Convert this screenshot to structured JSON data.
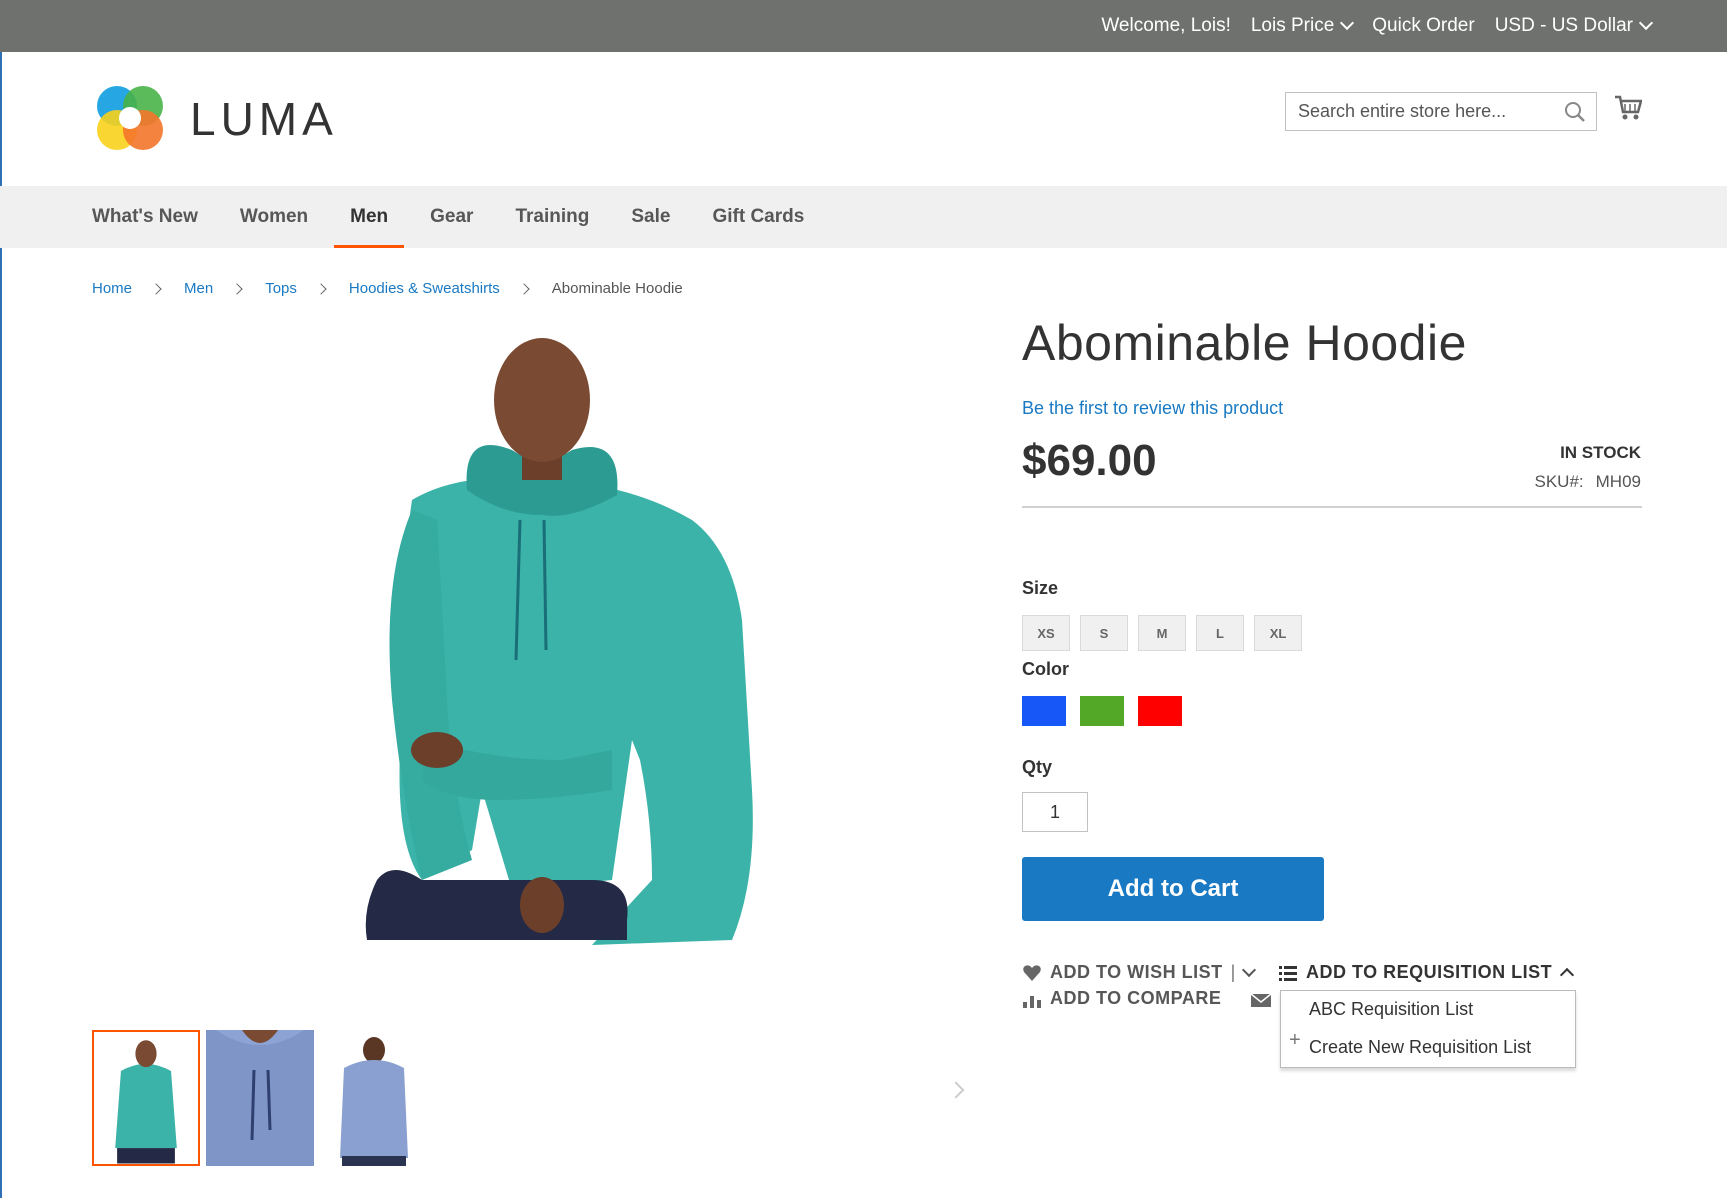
{
  "topbar": {
    "welcome": "Welcome, Lois!",
    "account": "Lois Price",
    "quick_order": "Quick Order",
    "currency": "USD - US Dollar"
  },
  "header": {
    "logo_text": "LUMA",
    "search_placeholder": "Search entire store here...",
    "icons": [
      "search-icon",
      "cart-icon"
    ]
  },
  "nav": {
    "items": [
      {
        "label": "What's New"
      },
      {
        "label": "Women"
      },
      {
        "label": "Men",
        "active": true
      },
      {
        "label": "Gear"
      },
      {
        "label": "Training"
      },
      {
        "label": "Sale"
      },
      {
        "label": "Gift Cards"
      }
    ]
  },
  "breadcrumb": {
    "items": [
      "Home",
      "Men",
      "Tops",
      "Hoodies & Sweatshirts"
    ],
    "current": "Abominable Hoodie"
  },
  "product": {
    "name": "Abominable Hoodie",
    "review_link": "Be the first to review this product",
    "price": "$69.00",
    "stock": "In stock",
    "sku_label": "SKU#:",
    "sku": "MH09",
    "size_label": "Size",
    "sizes": [
      "XS",
      "S",
      "M",
      "L",
      "XL"
    ],
    "color_label": "Color",
    "colors": [
      "#1857f7",
      "#53a828",
      "#ff0000"
    ],
    "qty_label": "Qty",
    "qty": "1",
    "add_to_cart": "Add to Cart",
    "main_image_color": "#3bb3a8",
    "thumb_count": 3
  },
  "actions": {
    "wish_list": "Add to Wish List",
    "compare": "Add to Compare",
    "requisition": "Add to Requisition List",
    "requisition_options": {
      "existing": "ABC Requisition List",
      "create": "Create New Requisition List"
    }
  },
  "theme": {
    "accent": "#ff5501",
    "primary": "#1979c3",
    "topbar_bg": "#6e716e",
    "nav_bg": "#f0f0f0"
  }
}
